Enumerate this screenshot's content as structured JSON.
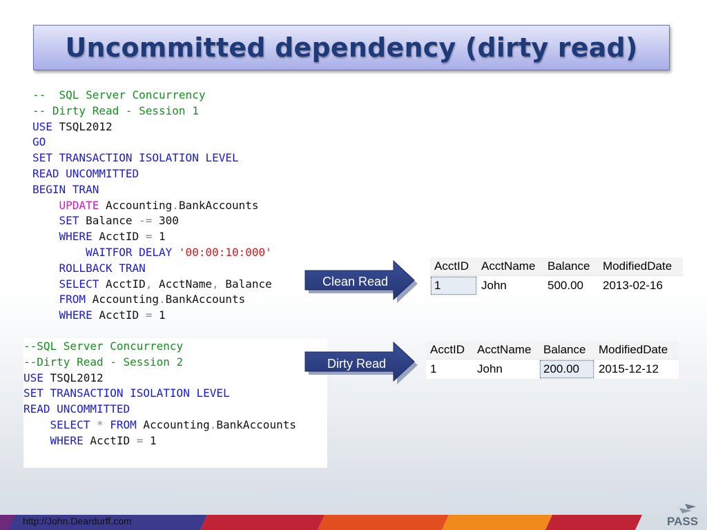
{
  "slide": {
    "title": "Uncommitted dependency (dirty read)",
    "footer_url": "http://John.Deardurff.com",
    "logo_text": "PASS"
  },
  "session1": {
    "lines": [
      [
        {
          "t": "--  SQL Server Concurrency",
          "c": "cm"
        }
      ],
      [
        {
          "t": "-- Dirty Read - Session 1",
          "c": "cm"
        }
      ],
      [
        {
          "t": "USE ",
          "c": "kw"
        },
        {
          "t": "TSQL2012",
          "c": "tx"
        }
      ],
      [
        {
          "t": "GO",
          "c": "kw"
        }
      ],
      [
        {
          "t": "SET TRANSACTION ISOLATION LEVEL",
          "c": "kw"
        }
      ],
      [
        {
          "t": "READ UNCOMMITTED",
          "c": "kw"
        }
      ],
      [
        {
          "t": "BEGIN TRAN",
          "c": "kw"
        }
      ],
      [
        {
          "t": "    ",
          "c": "tx"
        },
        {
          "t": "UPDATE ",
          "c": "mg"
        },
        {
          "t": "Accounting",
          "c": "tx"
        },
        {
          "t": ".",
          "c": "op"
        },
        {
          "t": "BankAccounts",
          "c": "tx"
        }
      ],
      [
        {
          "t": "    ",
          "c": "tx"
        },
        {
          "t": "SET ",
          "c": "kw"
        },
        {
          "t": "Balance ",
          "c": "tx"
        },
        {
          "t": "-= ",
          "c": "op"
        },
        {
          "t": "300",
          "c": "tx"
        }
      ],
      [
        {
          "t": "    ",
          "c": "tx"
        },
        {
          "t": "WHERE ",
          "c": "kw"
        },
        {
          "t": "AcctID ",
          "c": "tx"
        },
        {
          "t": "= ",
          "c": "op"
        },
        {
          "t": "1",
          "c": "tx"
        }
      ],
      [
        {
          "t": "        ",
          "c": "tx"
        },
        {
          "t": "WAITFOR DELAY ",
          "c": "kw"
        },
        {
          "t": "'00:00:10:000'",
          "c": "st"
        }
      ],
      [
        {
          "t": "    ",
          "c": "tx"
        },
        {
          "t": "ROLLBACK TRAN",
          "c": "kw"
        }
      ],
      [
        {
          "t": "    ",
          "c": "tx"
        },
        {
          "t": "SELECT ",
          "c": "kw"
        },
        {
          "t": "AcctID",
          "c": "tx"
        },
        {
          "t": ", ",
          "c": "op"
        },
        {
          "t": "AcctName",
          "c": "tx"
        },
        {
          "t": ", ",
          "c": "op"
        },
        {
          "t": "Balance",
          "c": "tx"
        }
      ],
      [
        {
          "t": "    ",
          "c": "tx"
        },
        {
          "t": "FROM ",
          "c": "kw"
        },
        {
          "t": "Accounting",
          "c": "tx"
        },
        {
          "t": ".",
          "c": "op"
        },
        {
          "t": "BankAccounts",
          "c": "tx"
        }
      ],
      [
        {
          "t": "    ",
          "c": "tx"
        },
        {
          "t": "WHERE ",
          "c": "kw"
        },
        {
          "t": "AcctID ",
          "c": "tx"
        },
        {
          "t": "= ",
          "c": "op"
        },
        {
          "t": "1",
          "c": "tx"
        }
      ]
    ]
  },
  "session2": {
    "lines": [
      [
        {
          "t": "--SQL Server Concurrency",
          "c": "cm"
        }
      ],
      [
        {
          "t": "--Dirty Read - Session 2",
          "c": "cm"
        }
      ],
      [
        {
          "t": "USE ",
          "c": "kw"
        },
        {
          "t": "TSQL2012",
          "c": "tx"
        }
      ],
      [
        {
          "t": "SET TRANSACTION ISOLATION LEVEL",
          "c": "kw"
        }
      ],
      [
        {
          "t": "READ UNCOMMITTED",
          "c": "kw"
        }
      ],
      [
        {
          "t": "    ",
          "c": "tx"
        },
        {
          "t": "SELECT ",
          "c": "kw"
        },
        {
          "t": "* ",
          "c": "op"
        },
        {
          "t": "FROM ",
          "c": "kw"
        },
        {
          "t": "Accounting",
          "c": "tx"
        },
        {
          "t": ".",
          "c": "op"
        },
        {
          "t": "BankAccounts",
          "c": "tx"
        }
      ],
      [
        {
          "t": "    ",
          "c": "tx"
        },
        {
          "t": "WHERE ",
          "c": "kw"
        },
        {
          "t": "AcctID ",
          "c": "tx"
        },
        {
          "t": "= ",
          "c": "op"
        },
        {
          "t": "1",
          "c": "tx"
        }
      ]
    ]
  },
  "arrows": {
    "clean": "Clean Read",
    "dirty": "Dirty Read"
  },
  "clean_result": {
    "headers": [
      "AcctID",
      "AcctName",
      "Balance",
      "ModifiedDate"
    ],
    "row": [
      "1",
      "John",
      "500.00",
      "2013-02-16"
    ]
  },
  "dirty_result": {
    "headers": [
      "AcctID",
      "AcctName",
      "Balance",
      "ModifiedDate"
    ],
    "row": [
      "1",
      "John",
      "200.00",
      "2015-12-12"
    ]
  },
  "colors": {
    "keyword": "#1a1ad6",
    "comment": "#14901e",
    "dml": "#d318c8",
    "string": "#d21a1a",
    "title": "#1f3a78",
    "arrow": "#2b3e80"
  }
}
